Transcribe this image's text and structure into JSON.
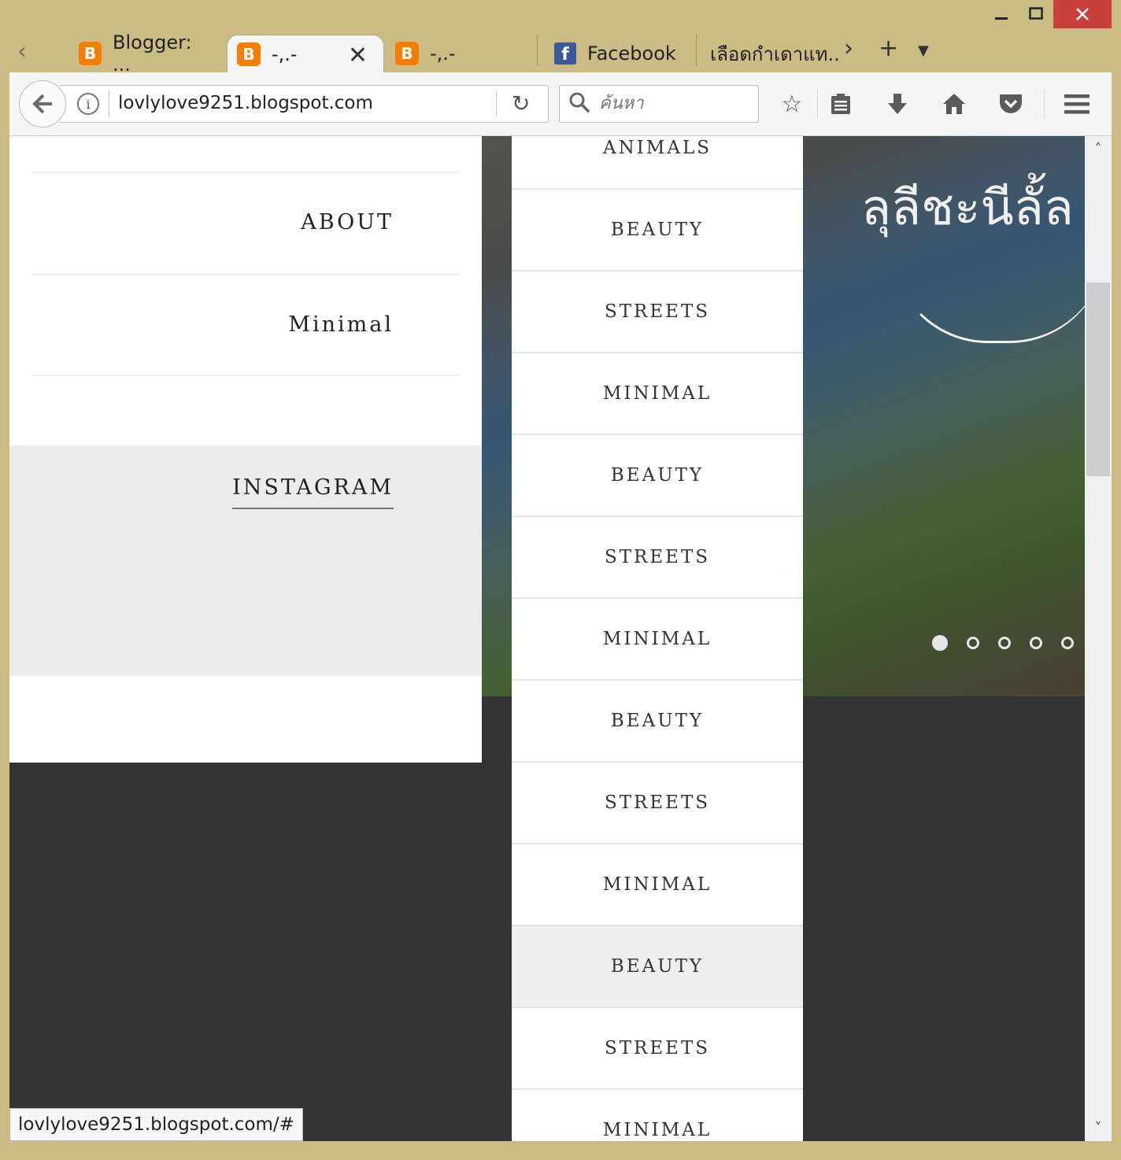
{
  "window": {
    "minimize_icon": "minimize-icon",
    "maximize_icon": "maximize-icon",
    "close_icon": "close-icon",
    "close_color": "#c9403a"
  },
  "tabs": [
    {
      "title": "Blogger: ...",
      "icon": "blogger-icon",
      "active": false
    },
    {
      "title": "-,.-",
      "icon": "blogger-icon",
      "active": true
    },
    {
      "title": "-,.-",
      "icon": "blogger-icon",
      "active": false
    },
    {
      "title": "Facebook",
      "icon": "facebook-icon",
      "active": false
    },
    {
      "title": "เลือดกำเดาแท...",
      "icon": "",
      "active": false
    }
  ],
  "icon_glyphs": {
    "blogger": "B",
    "facebook": "f"
  },
  "navbar": {
    "url": "lovlylove9251.blogspot.com",
    "search_placeholder": "ค้นหา"
  },
  "left_panel": {
    "items": [
      "ABOUT",
      "Minimal"
    ],
    "instagram_label": "INSTAGRAM"
  },
  "categories": [
    {
      "label": "ANIMALS",
      "highlighted": false
    },
    {
      "label": "BEAUTY",
      "highlighted": false
    },
    {
      "label": "STREETS",
      "highlighted": false
    },
    {
      "label": "MINIMAL",
      "highlighted": false
    },
    {
      "label": "BEAUTY",
      "highlighted": false
    },
    {
      "label": "STREETS",
      "highlighted": false
    },
    {
      "label": "MINIMAL",
      "highlighted": false
    },
    {
      "label": "BEAUTY",
      "highlighted": false
    },
    {
      "label": "STREETS",
      "highlighted": false
    },
    {
      "label": "MINIMAL",
      "highlighted": false
    },
    {
      "label": "BEAUTY",
      "highlighted": true
    },
    {
      "label": "STREETS",
      "highlighted": false
    },
    {
      "label": "MINIMAL",
      "highlighted": false
    }
  ],
  "hero": {
    "title": "ลุลีชะนีลั้ล",
    "slide_count": 5,
    "active_slide": 1
  },
  "status_bar": {
    "text": "lovlylove9251.blogspot.com/#"
  }
}
